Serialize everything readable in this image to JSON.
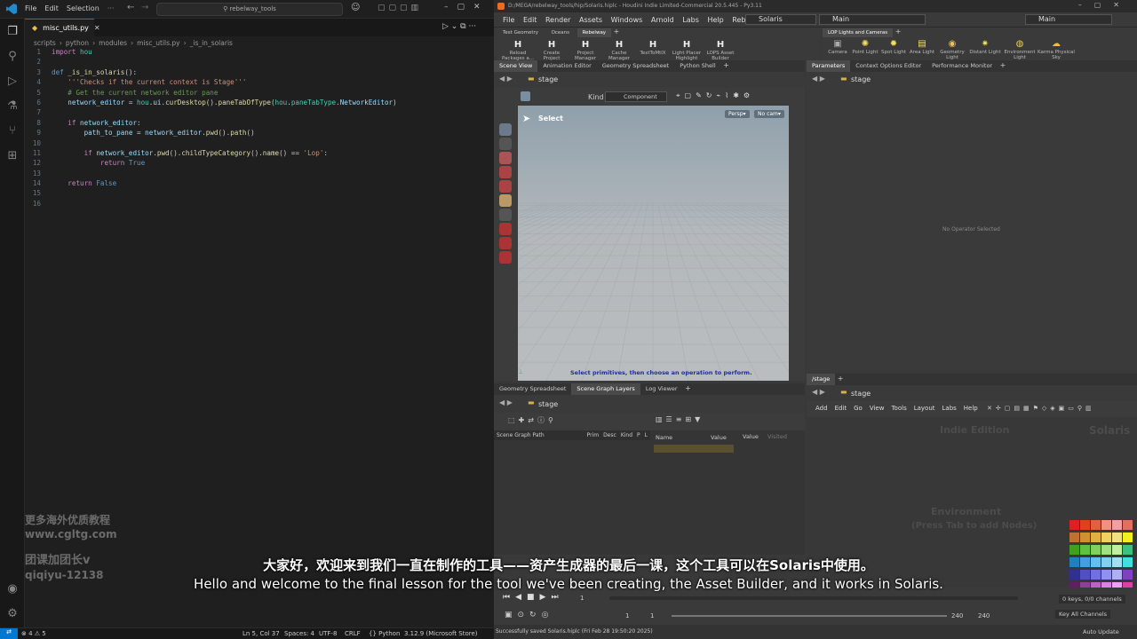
{
  "vscode": {
    "menu": [
      "File",
      "Edit",
      "Selection"
    ],
    "search_text": "rebelway_tools",
    "tab_label": "misc_utils.py",
    "breadcrumb": [
      "scripts",
      "python",
      "modules",
      "misc_utils.py",
      "_is_in_solaris"
    ],
    "code_lines": [
      {
        "n": "1",
        "html": "<span class='kc'>import</span> <span class='ty'>hou</span>"
      },
      {
        "n": "2",
        "html": ""
      },
      {
        "n": "3",
        "html": "<span class='kw'>def</span> <span class='fn'>_is_in_solaris</span>():"
      },
      {
        "n": "4",
        "html": "    <span class='st'>'''Checks if the current context is Stage'''</span>"
      },
      {
        "n": "5",
        "html": "    <span class='cm'># Get the current network editor pane</span>"
      },
      {
        "n": "6",
        "html": "    <span class='va'>network_editor</span> = <span class='ty'>hou</span>.<span class='va'>ui</span>.<span class='fn'>curDesktop</span>().<span class='fn'>paneTabOfType</span>(<span class='ty'>hou</span>.<span class='ty'>paneTabType</span>.<span class='va'>NetworkEditor</span>)"
      },
      {
        "n": "7",
        "html": ""
      },
      {
        "n": "8",
        "html": "    <span class='kc'>if</span> <span class='va'>network_editor</span>:"
      },
      {
        "n": "9",
        "html": "        <span class='va'>path_to_pane</span> = <span class='va'>network_editor</span>.<span class='fn'>pwd</span>().<span class='fn'>path</span>()"
      },
      {
        "n": "10",
        "html": ""
      },
      {
        "n": "11",
        "html": "        <span class='kc'>if</span> <span class='va'>network_editor</span>.<span class='fn'>pwd</span>().<span class='fn'>childTypeCategory</span>().<span class='fn'>name</span>() == <span class='st'>'Lop'</span>:"
      },
      {
        "n": "12",
        "html": "            <span class='kc'>return</span> <span class='kw'>True</span>"
      },
      {
        "n": "13",
        "html": ""
      },
      {
        "n": "14",
        "html": "    <span class='kc'>return</span> <span class='kw'>False</span>"
      },
      {
        "n": "15",
        "html": ""
      },
      {
        "n": "16",
        "html": ""
      }
    ],
    "status": {
      "errors": "⊗ 4 ⚠ 5",
      "position": "Ln 5, Col 37",
      "spaces": "Spaces: 4",
      "encoding": "UTF-8",
      "eol": "CRLF",
      "language": "Python",
      "interpreter": "3.12.9 (Microsoft Store)"
    }
  },
  "houdini": {
    "title": "D:/MEGA/rebelway_tools/hip/Solaris.hiplc - Houdini Indie Limited-Commercial 20.5.445 - Py3.11",
    "menu": [
      "File",
      "Edit",
      "Render",
      "Assets",
      "Windows",
      "Arnold",
      "Labs",
      "Help",
      "Rebelway Tools"
    ],
    "desktop": "Solaris",
    "main_left": "Main",
    "main_right": "Main",
    "shelf_tabs": [
      "Test Geometry",
      "Oceans",
      "Rebelway"
    ],
    "shelf_tools": [
      "Reload Packages a...",
      "Create Project",
      "Project Manager",
      "Cache Manager",
      "TextToMtlX",
      "Light Placer Highlight",
      "LOPS Asset Builder"
    ],
    "lop_shelf_tab": "LOP Lights and Cameras",
    "lop_tools": [
      "Camera",
      "Point Light",
      "Spot Light",
      "Area Light",
      "Geometry Light",
      "Distant Light",
      "Environment Light",
      "Karma Physical Sky"
    ],
    "view_tabs": [
      "Scene View",
      "Animation Editor",
      "Geometry Spreadsheet",
      "Python Shell"
    ],
    "param_tabs": [
      "Parameters",
      "Context Options Editor",
      "Performance Monitor"
    ],
    "path_stage": "stage",
    "kind_label": "Kind",
    "component_label": "Component",
    "select_label": "Select",
    "persp": "Persp",
    "nocam": "No cam",
    "viewport_hint": "Select primitives, then choose an operation to perform.",
    "no_operator": "No Operator Selected",
    "lower_tabs": [
      "Geometry Spreadsheet",
      "Scene Graph Layers",
      "Log Viewer"
    ],
    "sg_cols": [
      "Scene Graph Path",
      "Prim",
      "Desc",
      "Kind",
      "P",
      "L"
    ],
    "name_col": "Name",
    "value_col": "Value",
    "value2": "Value",
    "value3": "Visited",
    "net_tab": "/stage",
    "net_menu": [
      "Add",
      "Edit",
      "Go",
      "View",
      "Tools",
      "Layout",
      "Labs",
      "Help"
    ],
    "indie": "Indie Edition",
    "solaris_wm": "Solaris",
    "env_text1": "Environment",
    "env_text2": "(Press Tab to add Nodes)",
    "frame_start": "1",
    "frame_cur": "1",
    "frame_a": "1",
    "frame_b": "1",
    "frame_end": "240",
    "frame_end2": "240",
    "keys": "0 keys, 0/0 channels",
    "key_all": "Key All Channels",
    "status_msg": "Successfully saved Solaris.hiplc (Fri Feb 28 19:50:20 2025)",
    "auto_update": "Auto Update",
    "swatches": [
      "#e02020",
      "#e04020",
      "#e06040",
      "#f09080",
      "#f0a0a0",
      "#e07060",
      "#c07030",
      "#d09030",
      "#e0b040",
      "#f0d060",
      "#f0e080",
      "#f0f020",
      "#40a020",
      "#60c040",
      "#80d060",
      "#a0e080",
      "#c0f0a0",
      "#40c080",
      "#2080c0",
      "#40a0e0",
      "#60c0f0",
      "#80d0f0",
      "#a0e0f0",
      "#40e0e0",
      "#303090",
      "#5050c0",
      "#7070e0",
      "#9090f0",
      "#b0b0f0",
      "#8040c0",
      "#602060",
      "#904090",
      "#c060c0",
      "#e080e0",
      "#f0a0f0",
      "#e040a0",
      "#202020",
      "#505050",
      "#808080",
      "#a0a0a0",
      "#d0d0d0",
      "#ffffff"
    ]
  },
  "subtitle": {
    "zh": "大家好，欢迎来到我们一直在制作的工具——资产生成器的最后一课，这个工具可以在Solaris中使用。",
    "en": "Hello and welcome to the final lesson for the tool we've been creating, the Asset Builder, and it works in Solaris."
  },
  "watermark": {
    "line1": "更多海外优质教程",
    "line2": "www.cgltg.com",
    "line3": "团课加团长v",
    "line4": "qiqiyu-12138"
  }
}
